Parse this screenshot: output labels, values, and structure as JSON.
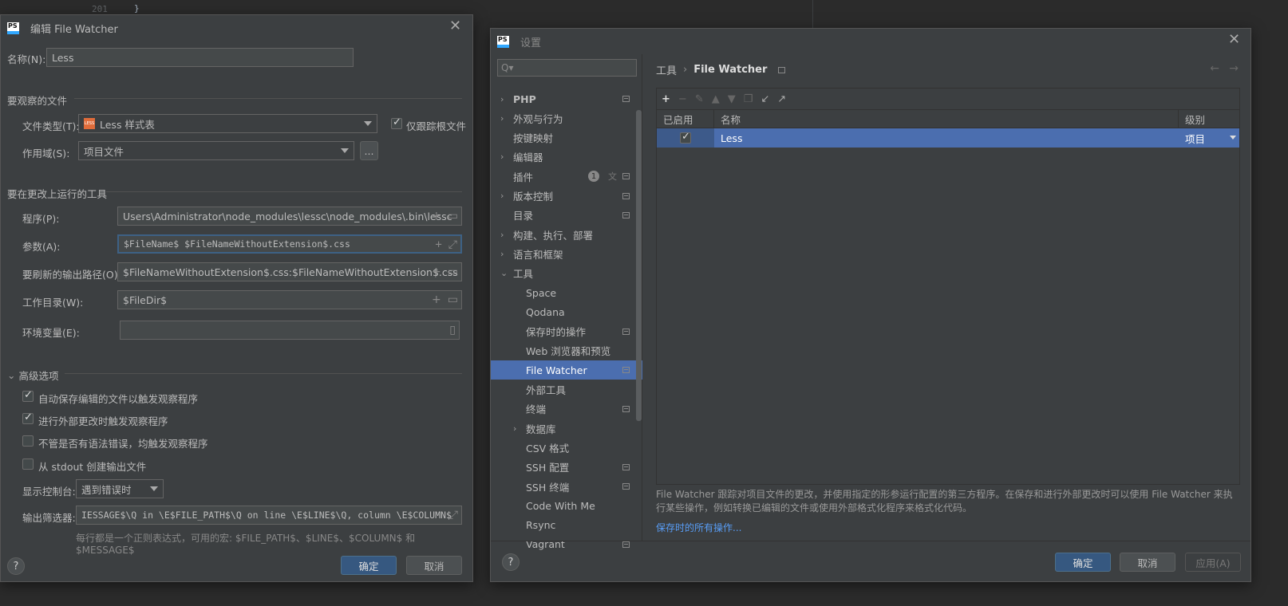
{
  "editor": {
    "line_number": "201",
    "brace": "}"
  },
  "edit_dialog": {
    "title": "编辑 File Watcher",
    "name_label": "名称(N):",
    "name_value": "Less",
    "watch_section": "要观察的文件",
    "file_type_label": "文件类型(T):",
    "file_type_value": "Less 样式表",
    "file_type_badge": "LESS",
    "track_root_label": "仅跟踪根文件",
    "scope_label": "作用域(S):",
    "scope_value": "项目文件",
    "scope_more": "...",
    "tool_section": "要在更改上运行的工具",
    "program_label": "程序(P):",
    "program_value": "Users\\Administrator\\node_modules\\lessc\\node_modules\\.bin\\lessc",
    "args_label": "参数(A):",
    "args_value": "$FileName$ $FileNameWithoutExtension$.css",
    "output_label": "要刷新的输出路径(O):",
    "output_value": "$FileNameWithoutExtension$.css:$FileNameWithoutExtension$.css",
    "workdir_label": "工作目录(W):",
    "workdir_value": "$FileDir$",
    "env_label": "环境变量(E):",
    "env_value": "",
    "advanced_section": "高级选项",
    "opt1": "自动保存编辑的文件以触发观察程序",
    "opt2": "进行外部更改时触发观察程序",
    "opt3": "不管是否有语法错误，均触发观察程序",
    "opt4": "从 stdout 创建输出文件",
    "console_label": "显示控制台:",
    "console_value": "遇到错误时",
    "filter_label": "输出筛选器:",
    "filter_value": "IESSAGE$\\Q in \\E$FILE_PATH$\\Q on line \\E$LINE$\\Q, column \\E$COLUMN$",
    "filter_hint": "每行都是一个正则表达式，可用的宏: $FILE_PATH$、$LINE$、$COLUMN$ 和 $MESSAGE$",
    "ok": "确定",
    "cancel": "取消",
    "help": "?"
  },
  "settings": {
    "title": "设置",
    "search_placeholder": "Q▾",
    "tree": [
      {
        "label": "PHP",
        "chevron": ">",
        "indent": 0,
        "pin": true,
        "bold": true
      },
      {
        "label": "外观与行为",
        "chevron": ">",
        "indent": 0,
        "pin": false
      },
      {
        "label": "按键映射",
        "chevron": "",
        "indent": 0,
        "pin": false
      },
      {
        "label": "编辑器",
        "chevron": ">",
        "indent": 0,
        "pin": false
      },
      {
        "label": "插件",
        "chevron": "",
        "indent": 0,
        "pin": true,
        "badge": "1"
      },
      {
        "label": "版本控制",
        "chevron": ">",
        "indent": 0,
        "pin": true
      },
      {
        "label": "目录",
        "chevron": "",
        "indent": 0,
        "pin": true
      },
      {
        "label": "构建、执行、部署",
        "chevron": ">",
        "indent": 0,
        "pin": false
      },
      {
        "label": "语言和框架",
        "chevron": ">",
        "indent": 0,
        "pin": false
      },
      {
        "label": "工具",
        "chevron": "v",
        "indent": 0,
        "pin": false
      },
      {
        "label": "Space",
        "chevron": "",
        "indent": 1,
        "pin": false
      },
      {
        "label": "Qodana",
        "chevron": "",
        "indent": 1,
        "pin": false
      },
      {
        "label": "保存时的操作",
        "chevron": "",
        "indent": 1,
        "pin": true
      },
      {
        "label": "Web 浏览器和预览",
        "chevron": "",
        "indent": 1,
        "pin": false
      },
      {
        "label": "File Watcher",
        "chevron": "",
        "indent": 1,
        "pin": true,
        "selected": true
      },
      {
        "label": "外部工具",
        "chevron": "",
        "indent": 1,
        "pin": false
      },
      {
        "label": "终端",
        "chevron": "",
        "indent": 1,
        "pin": true
      },
      {
        "label": "数据库",
        "chevron": ">",
        "indent": 1,
        "pin": false
      },
      {
        "label": "CSV 格式",
        "chevron": "",
        "indent": 1,
        "pin": false
      },
      {
        "label": "SSH 配置",
        "chevron": "",
        "indent": 1,
        "pin": true
      },
      {
        "label": "SSH 终端",
        "chevron": "",
        "indent": 1,
        "pin": true
      },
      {
        "label": "Code With Me",
        "chevron": "",
        "indent": 1,
        "pin": false
      },
      {
        "label": "Rsync",
        "chevron": "",
        "indent": 1,
        "pin": false
      },
      {
        "label": "Vagrant",
        "chevron": "",
        "indent": 1,
        "pin": true
      }
    ],
    "breadcrumb_parent": "工具",
    "breadcrumb_sep": "›",
    "breadcrumb_current": "File Watcher",
    "table_headers": {
      "enabled": "已启用",
      "name": "名称",
      "level": "级别"
    },
    "table_rows": [
      {
        "enabled": true,
        "name": "Less",
        "level": "项目"
      }
    ],
    "description": "File Watcher 跟踪对项目文件的更改，并使用指定的形参运行配置的第三方程序。在保存和进行外部更改时可以使用 File Watcher 来执行某些操作，例如转换已编辑的文件或使用外部格式化程序来格式化代码。",
    "link": "保存时的所有操作...",
    "ok": "确定",
    "cancel": "取消",
    "apply": "应用(A)",
    "help": "?"
  }
}
